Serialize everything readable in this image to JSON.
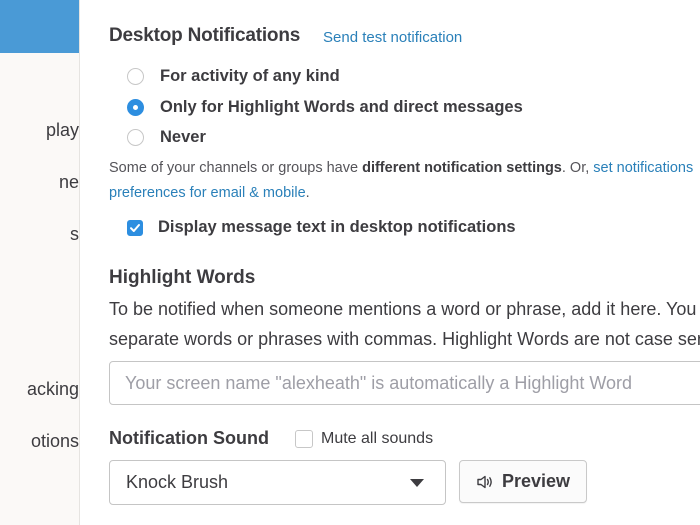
{
  "sidebar": {
    "items": [
      {
        "label": "play"
      },
      {
        "label": "ne"
      },
      {
        "label": "s"
      },
      {
        "label": "acking"
      },
      {
        "label": "otions"
      }
    ],
    "active_color": "#4a9ad6"
  },
  "desktop_notifications": {
    "title": "Desktop Notifications",
    "test_link": "Send test notification",
    "options": [
      {
        "label": "For activity of any kind",
        "selected": false
      },
      {
        "label": "Only for Highlight Words and direct messages",
        "selected": true
      },
      {
        "label": "Never",
        "selected": false
      }
    ],
    "info_prefix": "Some of your channels or groups have ",
    "info_bold": "different notification settings",
    "info_middle": ". Or, ",
    "info_link_line1": "set notifications",
    "info_link_line2": "preferences for email & mobile",
    "info_suffix": ".",
    "display_text_checkbox": {
      "label": "Display message text in desktop notifications",
      "checked": true
    }
  },
  "highlight_words": {
    "title": "Highlight Words",
    "description_line1": "To be notified when someone mentions a word or phrase, add it here. You can",
    "description_line2": "separate words or phrases with commas. Highlight Words are not case sensitive.",
    "input_value": "",
    "input_placeholder": "Your screen name \"alexheath\" is automatically a Highlight Word"
  },
  "notification_sound": {
    "title": "Notification Sound",
    "mute_label": "Mute all sounds",
    "mute_checked": false,
    "selected_sound": "Knock Brush",
    "preview_label": "Preview"
  },
  "colors": {
    "accent": "#2d8ee0",
    "link": "#2a80b9",
    "text": "#3d3c40"
  }
}
